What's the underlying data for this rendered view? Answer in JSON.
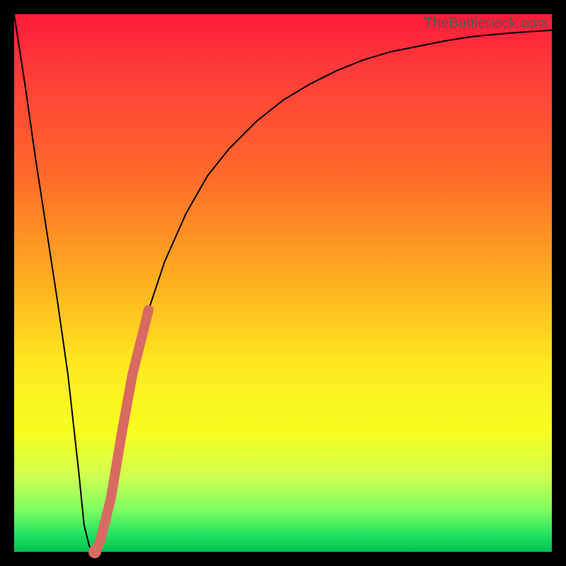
{
  "watermark": "TheBottleneck.com",
  "colors": {
    "frame": "#000000",
    "accent_stroke": "#d96a62",
    "gradient_top": "#ff1a3a",
    "gradient_mid": "#ffe820",
    "gradient_bottom": "#00c050"
  },
  "chart_data": {
    "type": "line",
    "title": "",
    "xlabel": "",
    "ylabel": "",
    "xlim": [
      0,
      100
    ],
    "ylim": [
      0,
      100
    ],
    "x": [
      0,
      2,
      4,
      6,
      8,
      10,
      12,
      13,
      14,
      15,
      16,
      18,
      20,
      22,
      25,
      28,
      32,
      36,
      40,
      45,
      50,
      55,
      60,
      65,
      70,
      75,
      80,
      85,
      90,
      95,
      100
    ],
    "series": [
      {
        "name": "bottleneck_curve",
        "values": [
          100,
          87,
          73,
          60,
          47,
          33,
          15,
          5,
          1,
          0,
          2,
          10,
          22,
          33,
          45,
          54,
          63,
          70,
          75,
          80,
          84,
          87,
          89.5,
          91.5,
          93,
          94,
          95,
          95.8,
          96.3,
          96.7,
          97
        ]
      }
    ],
    "accent_segment": {
      "name": "highlighted_range",
      "x_start": 15,
      "x_end": 25,
      "note": "thick salmon stroke following the main curve between these x values"
    },
    "minimum_point": {
      "x": 15,
      "y": 0
    }
  }
}
